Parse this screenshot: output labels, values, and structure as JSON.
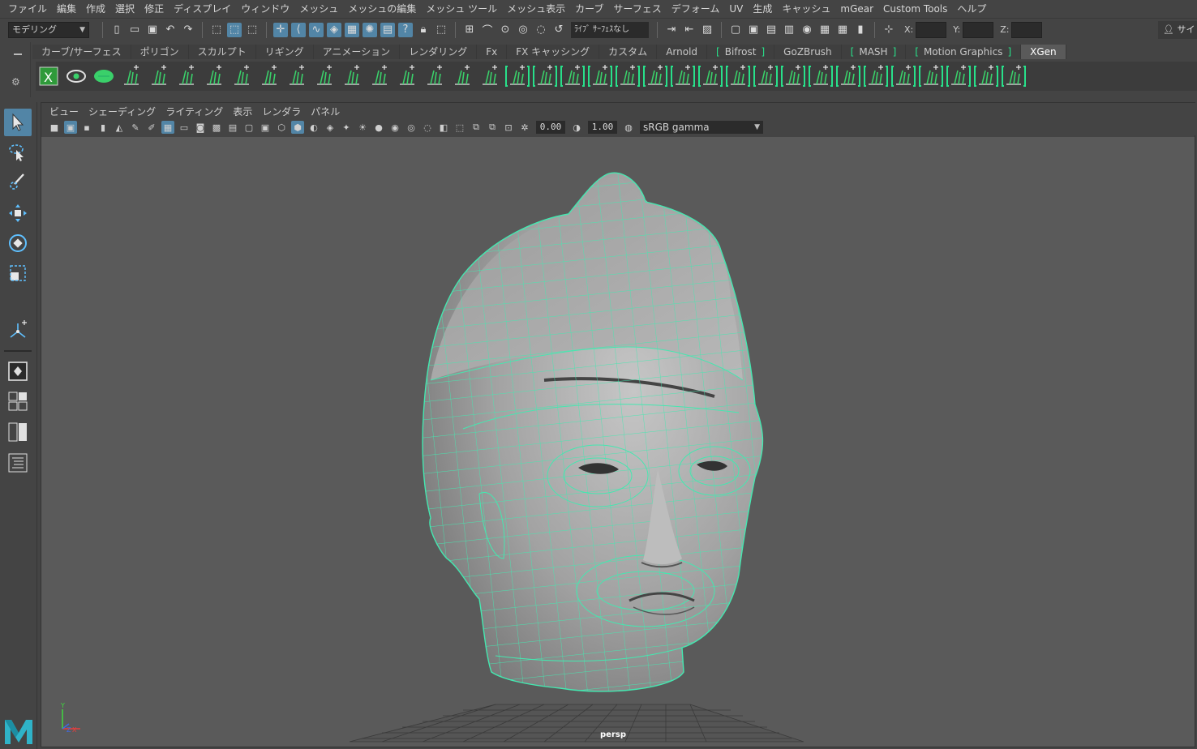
{
  "menubar": {
    "items": [
      "ファイル",
      "編集",
      "作成",
      "選択",
      "修正",
      "ディスプレイ",
      "ウィンドウ",
      "メッシュ",
      "メッシュの編集",
      "メッシュ ツール",
      "メッシュ表示",
      "カーブ",
      "サーフェス",
      "デフォーム",
      "UV",
      "生成",
      "キャッシュ",
      "mGear",
      "Custom Tools",
      "ヘルプ"
    ]
  },
  "statusline": {
    "mode": "モデリング",
    "live_surface": "ﾗｲﾌﾞ ｻｰﾌｪｽなし",
    "coord_x_label": "X:",
    "coord_y_label": "Y:",
    "coord_z_label": "Z:",
    "sign_in": "サイ"
  },
  "shelf": {
    "tabs": [
      {
        "label": "カーブ/サーフェス",
        "bracketed": false,
        "active": false
      },
      {
        "label": "ポリゴン",
        "bracketed": false,
        "active": false
      },
      {
        "label": "スカルプト",
        "bracketed": false,
        "active": false
      },
      {
        "label": "リギング",
        "bracketed": false,
        "active": false
      },
      {
        "label": "アニメーション",
        "bracketed": false,
        "active": false
      },
      {
        "label": "レンダリング",
        "bracketed": false,
        "active": false
      },
      {
        "label": "Fx",
        "bracketed": false,
        "active": false
      },
      {
        "label": "FX キャッシング",
        "bracketed": false,
        "active": false
      },
      {
        "label": "カスタム",
        "bracketed": false,
        "active": false
      },
      {
        "label": "Arnold",
        "bracketed": false,
        "active": false
      },
      {
        "label": "Bifrost",
        "bracketed": true,
        "active": false
      },
      {
        "label": "GoZBrush",
        "bracketed": false,
        "active": false
      },
      {
        "label": "MASH",
        "bracketed": true,
        "active": false
      },
      {
        "label": "Motion Graphics",
        "bracketed": true,
        "active": false
      },
      {
        "label": "XGen",
        "bracketed": false,
        "active": true
      }
    ],
    "accent_color": "#28e08a"
  },
  "panel": {
    "menu": [
      "ビュー",
      "シェーディング",
      "ライティング",
      "表示",
      "レンダラ",
      "パネル"
    ],
    "exposure": "0.00",
    "gamma": "1.00",
    "color_space": "sRGB gamma"
  },
  "viewport": {
    "camera": "persp",
    "wire_color": "#44e8b0",
    "background": "#5a5a5a"
  }
}
